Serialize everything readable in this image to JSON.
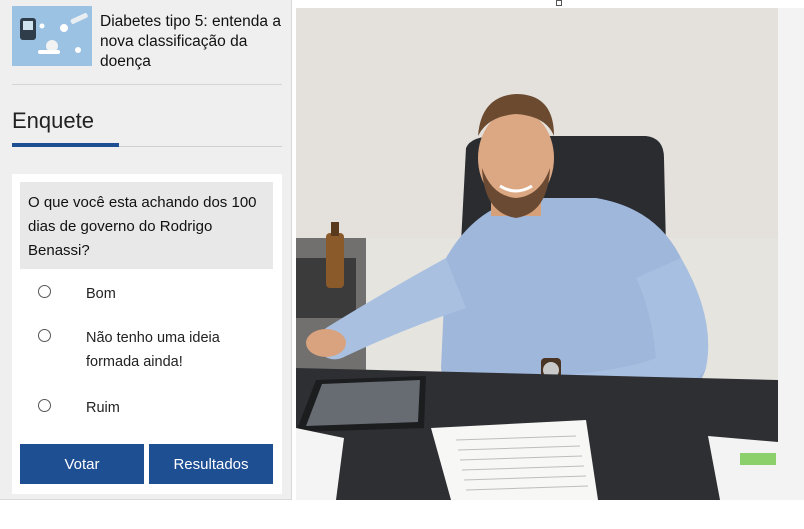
{
  "news": {
    "title": "Diabetes tipo 5: entenda a nova classificação da doença"
  },
  "poll": {
    "heading": "Enquete",
    "question": "O que você esta achando dos 100 dias de governo do Rodrigo Benassi?",
    "options": [
      {
        "label": "Bom"
      },
      {
        "label": "Não tenho uma ideia formada ainda!"
      },
      {
        "label": "Ruim"
      }
    ],
    "vote_label": "Votar",
    "results_label": "Resultados"
  },
  "colors": {
    "accent": "#1f4f93",
    "sidebar_bg": "#efefef",
    "question_bg": "#e8e8e8"
  },
  "icons": {
    "radio": "radio-unselected-icon"
  }
}
